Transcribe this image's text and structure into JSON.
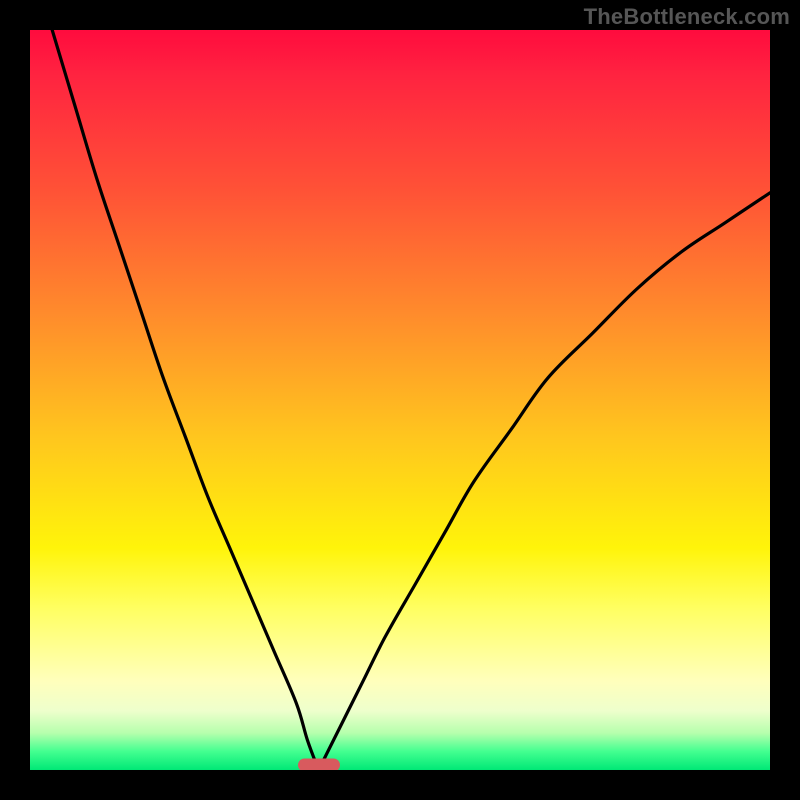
{
  "watermark": {
    "text": "TheBottleneck.com"
  },
  "chart_data": {
    "type": "line",
    "title": "",
    "xlabel": "",
    "ylabel": "",
    "xlim": [
      0,
      100
    ],
    "ylim": [
      0,
      100
    ],
    "grid": false,
    "legend_position": "none",
    "ideal_x": 39,
    "series": [
      {
        "name": "left-curve",
        "x": [
          3,
          6,
          9,
          12,
          15,
          18,
          21,
          24,
          27,
          30,
          33,
          36,
          37.5,
          39
        ],
        "y": [
          100,
          90,
          80,
          71,
          62,
          53,
          45,
          37,
          30,
          23,
          16,
          9,
          4,
          0
        ]
      },
      {
        "name": "right-curve",
        "x": [
          39,
          42,
          45,
          48,
          52,
          56,
          60,
          65,
          70,
          76,
          82,
          88,
          94,
          100
        ],
        "y": [
          0,
          6,
          12,
          18,
          25,
          32,
          39,
          46,
          53,
          59,
          65,
          70,
          74,
          78
        ]
      }
    ],
    "marker": {
      "x": 39,
      "y": 0,
      "color": "#d85a5e",
      "shape": "pill"
    },
    "background_gradient": {
      "top": "#ff0b3e",
      "mid": "#ffd400",
      "bottom": "#00e876"
    }
  }
}
